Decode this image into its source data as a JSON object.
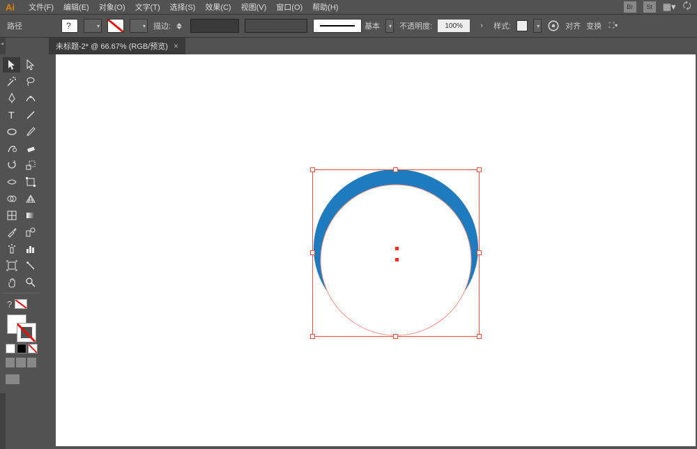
{
  "app": {
    "logo": "Ai"
  },
  "menu": {
    "file": "文件(F)",
    "edit": "编辑(E)",
    "object": "对象(O)",
    "type": "文字(T)",
    "select": "选择(S)",
    "effect": "效果(C)",
    "view": "视图(V)",
    "window": "窗口(O)",
    "help": "帮助(H)"
  },
  "menubar_right": {
    "br": "Br",
    "st": "St",
    "layout_icon": "layout-icon",
    "cloud_icon": "cloud-icon"
  },
  "controlbar": {
    "path_label": "路径",
    "stroke_label": "描边:",
    "stroke_pt": "",
    "basic_label": "基本",
    "opacity_label": "不透明度:",
    "opacity_value": "100%",
    "style_label": "样式:",
    "align_label": "对齐",
    "transform_label": "变换"
  },
  "doc": {
    "tab_title": "未标题-2* @ 66.67% (RGB/预览)",
    "tab_close": "×"
  },
  "tools": {
    "selection": "selection-tool",
    "direct": "direct-selection-tool",
    "wand": "magic-wand-tool",
    "lasso": "lasso-tool",
    "pen": "pen-tool",
    "curvature": "curvature-tool",
    "type": "type-tool",
    "line": "line-segment-tool",
    "ellipse": "ellipse-tool",
    "brush": "paintbrush-tool",
    "shaper": "shaper-tool",
    "eraser": "eraser-tool",
    "rotate": "rotate-tool",
    "scale": "scale-tool",
    "width": "width-tool",
    "freetrans": "free-transform-tool",
    "shapebuild": "shape-builder-tool",
    "perspective": "perspective-grid-tool",
    "mesh": "mesh-tool",
    "gradient": "gradient-tool",
    "eyedrop": "eyedropper-tool",
    "blend": "blend-tool",
    "symbolspray": "symbol-sprayer-tool",
    "graph": "column-graph-tool",
    "artboard": "artboard-tool",
    "slice": "slice-tool",
    "hand": "hand-tool",
    "zoom": "zoom-tool"
  },
  "canvas": {
    "shape_color": "#1e7bbd",
    "selection_color": "#ff4a3a"
  }
}
